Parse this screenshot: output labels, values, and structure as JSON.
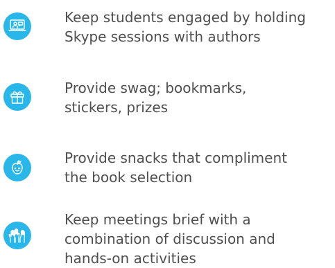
{
  "accent_color": "#29b6e8",
  "items": [
    {
      "icon": "video-chat-icon",
      "lines": [
        "Keep students engaged by holding",
        "Skype sessions with authors"
      ]
    },
    {
      "icon": "gift-icon",
      "lines": [
        "Provide swag; bookmarks,",
        "stickers, prizes"
      ]
    },
    {
      "icon": "apple-icon",
      "lines": [
        "Provide snacks that compliment",
        "the book selection"
      ]
    },
    {
      "icon": "raised-hands-icon",
      "lines": [
        "Keep meetings brief with a",
        "combination of discussion and",
        "hands-on activities"
      ]
    }
  ]
}
